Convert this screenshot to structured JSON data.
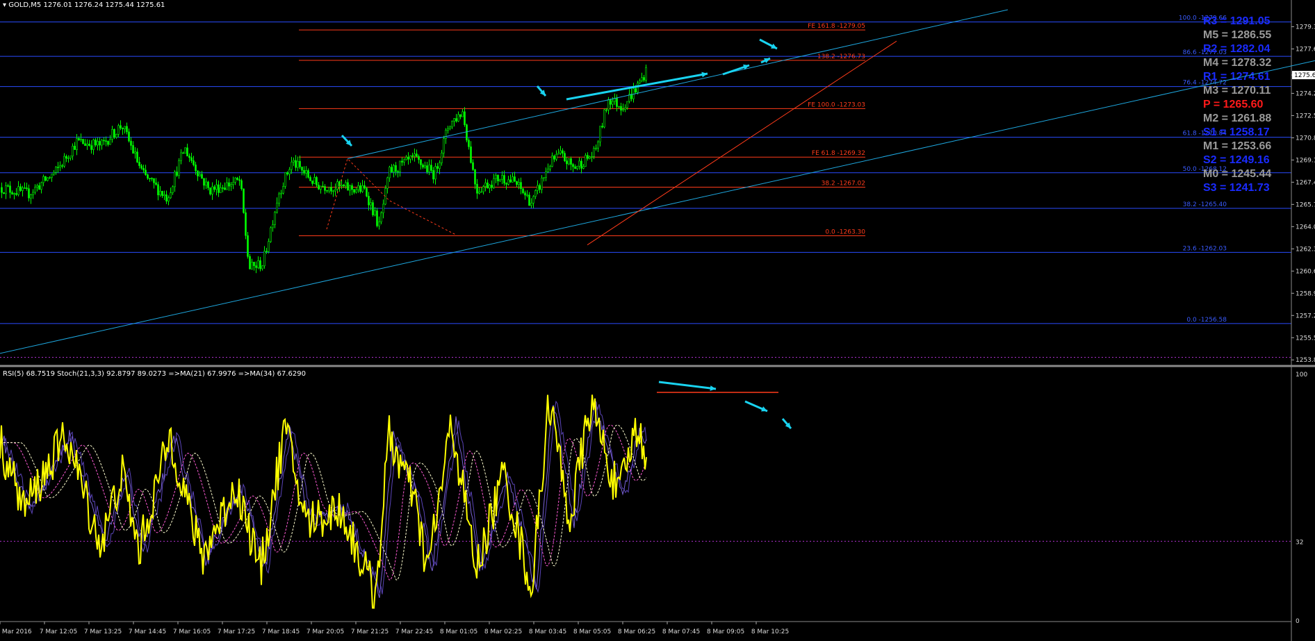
{
  "header": {
    "symbol": "GOLD,M5",
    "ohlc": "1276.01 1276.24 1275.44 1275.61"
  },
  "indicator_header": {
    "text": "RSI(5) 68.7519  Stoch(21,3,3) 92.8797 89.0273  =>MA(21) 67.9976  =>MA(34) 67.6290"
  },
  "colors": {
    "background": "#000000",
    "candle": "#00ff00",
    "fib_red": "#ff3b1a",
    "fib_blue": "#2a4bff",
    "channel": "#1ea8e0",
    "arrow": "#19d3f0",
    "rsi": "#ffff00",
    "stoch": "#7b63d6",
    "ma_dash": "#ff5bd6",
    "ma_dash2": "#ffffd0"
  },
  "chart_data": {
    "type": "candlestick",
    "price_axis": [
      "1279.3",
      "1277.6",
      "1275.6",
      "1274.2",
      "1272.5",
      "1270.8",
      "1269.1",
      "1267.4",
      "1265.7",
      "1264.0",
      "1262.3",
      "1260.6",
      "1258.9",
      "1257.2",
      "1255.5",
      "1253.8"
    ],
    "current_price": "1275.6",
    "ylim": [
      1253.6,
      1280.6
    ],
    "time_axis": [
      "7 Mar 2016",
      "7 Mar 12:05",
      "7 Mar 13:25",
      "7 Mar 14:45",
      "7 Mar 16:05",
      "7 Mar 17:25",
      "7 Mar 18:45",
      "7 Mar 20:05",
      "7 Mar 21:25",
      "7 Mar 22:45",
      "8 Mar 01:05",
      "8 Mar 02:25",
      "8 Mar 03:45",
      "8 Mar 05:05",
      "8 Mar 06:25",
      "8 Mar 07:45",
      "8 Mar 09:05",
      "8 Mar 10:25"
    ],
    "fib_red": [
      {
        "label": "FE 161.8 -1279.05",
        "price": 1279.05
      },
      {
        "label": "138.2 -1276.73",
        "price": 1276.73
      },
      {
        "label": "FE 100.0 -1273.03",
        "price": 1273.03
      },
      {
        "label": "FE 61.8 -1269.32",
        "price": 1269.32
      },
      {
        "label": "38.2 -1267.02",
        "price": 1267.02
      },
      {
        "label": "0.0 -1263.30",
        "price": 1263.3
      }
    ],
    "fib_blue": [
      {
        "label": "100.0 -1279.66",
        "price": 1279.66
      },
      {
        "label": "86.6 -1277.03",
        "price": 1277.03
      },
      {
        "label": "76.4 -1274.72",
        "price": 1274.72
      },
      {
        "label": "61.8 -1270.84",
        "price": 1270.84
      },
      {
        "label": "50.0 -1268.12",
        "price": 1268.12
      },
      {
        "label": "38.2 -1265.40",
        "price": 1265.4
      },
      {
        "label": "23.6 -1262.03",
        "price": 1262.03
      },
      {
        "label": "0.0 -1256.58",
        "price": 1256.58
      }
    ],
    "pivots": [
      {
        "label": "R3 = 1291.05",
        "color": "#1a2bff"
      },
      {
        "label": "M5 = 1286.55",
        "color": "#9a9a9a"
      },
      {
        "label": "R2 = 1282.04",
        "color": "#1a2bff"
      },
      {
        "label": "M4 = 1278.32",
        "color": "#9a9a9a"
      },
      {
        "label": "R1 = 1274.61",
        "color": "#1a2bff"
      },
      {
        "label": "M3 = 1270.11",
        "color": "#9a9a9a"
      },
      {
        "label": "P  = 1265.60",
        "color": "#ff1a1a"
      },
      {
        "label": "M2 = 1261.88",
        "color": "#9a9a9a"
      },
      {
        "label": "S1 = 1258.17",
        "color": "#1a2bff"
      },
      {
        "label": "M1 = 1253.66",
        "color": "#9a9a9a"
      },
      {
        "label": "S2 = 1249.16",
        "color": "#1a2bff"
      },
      {
        "label": "M0 = 1245.44",
        "color": "#9a9a9a"
      },
      {
        "label": "S3 = 1241.73",
        "color": "#1a2bff"
      }
    ],
    "indicator_axis": [
      "100",
      "32",
      "0"
    ],
    "indicator_levels": [
      100,
      32,
      0
    ],
    "anchors": [
      {
        "x": 0,
        "p": 1267.0
      },
      {
        "x": 40,
        "p": 1266.5
      },
      {
        "x": 80,
        "p": 1268.2
      },
      {
        "x": 110,
        "p": 1270.5
      },
      {
        "x": 145,
        "p": 1270.2
      },
      {
        "x": 175,
        "p": 1271.8
      },
      {
        "x": 205,
        "p": 1268.0
      },
      {
        "x": 240,
        "p": 1266.2
      },
      {
        "x": 265,
        "p": 1270.0
      },
      {
        "x": 300,
        "p": 1266.8
      },
      {
        "x": 345,
        "p": 1267.5
      },
      {
        "x": 358,
        "p": 1260.8
      },
      {
        "x": 378,
        "p": 1261.2
      },
      {
        "x": 400,
        "p": 1266.5
      },
      {
        "x": 420,
        "p": 1269.0
      },
      {
        "x": 455,
        "p": 1267.2
      },
      {
        "x": 490,
        "p": 1267.0
      },
      {
        "x": 525,
        "p": 1266.8
      },
      {
        "x": 545,
        "p": 1264.0
      },
      {
        "x": 560,
        "p": 1268.2
      },
      {
        "x": 595,
        "p": 1269.2
      },
      {
        "x": 625,
        "p": 1268.0
      },
      {
        "x": 645,
        "p": 1271.8
      },
      {
        "x": 665,
        "p": 1272.8
      },
      {
        "x": 685,
        "p": 1266.8
      },
      {
        "x": 720,
        "p": 1267.8
      },
      {
        "x": 740,
        "p": 1267.4
      },
      {
        "x": 765,
        "p": 1265.8
      },
      {
        "x": 790,
        "p": 1268.8
      },
      {
        "x": 805,
        "p": 1269.5
      },
      {
        "x": 825,
        "p": 1268.5
      },
      {
        "x": 855,
        "p": 1269.6
      },
      {
        "x": 875,
        "p": 1273.8
      },
      {
        "x": 895,
        "p": 1273.2
      },
      {
        "x": 915,
        "p": 1274.6
      },
      {
        "x": 930,
        "p": 1276.0
      }
    ],
    "rsi_anchors": [
      {
        "x": 0,
        "v": 72
      },
      {
        "x": 35,
        "v": 45
      },
      {
        "x": 95,
        "v": 75
      },
      {
        "x": 145,
        "v": 30
      },
      {
        "x": 175,
        "v": 60
      },
      {
        "x": 200,
        "v": 28
      },
      {
        "x": 245,
        "v": 75
      },
      {
        "x": 290,
        "v": 25
      },
      {
        "x": 340,
        "v": 55
      },
      {
        "x": 375,
        "v": 20
      },
      {
        "x": 410,
        "v": 78
      },
      {
        "x": 440,
        "v": 40
      },
      {
        "x": 490,
        "v": 45
      },
      {
        "x": 540,
        "v": 10
      },
      {
        "x": 560,
        "v": 75
      },
      {
        "x": 595,
        "v": 50
      },
      {
        "x": 615,
        "v": 20
      },
      {
        "x": 650,
        "v": 80
      },
      {
        "x": 685,
        "v": 20
      },
      {
        "x": 725,
        "v": 60
      },
      {
        "x": 765,
        "v": 12
      },
      {
        "x": 790,
        "v": 90
      },
      {
        "x": 820,
        "v": 40
      },
      {
        "x": 850,
        "v": 88
      },
      {
        "x": 890,
        "v": 50
      },
      {
        "x": 915,
        "v": 78
      },
      {
        "x": 930,
        "v": 68
      }
    ]
  }
}
